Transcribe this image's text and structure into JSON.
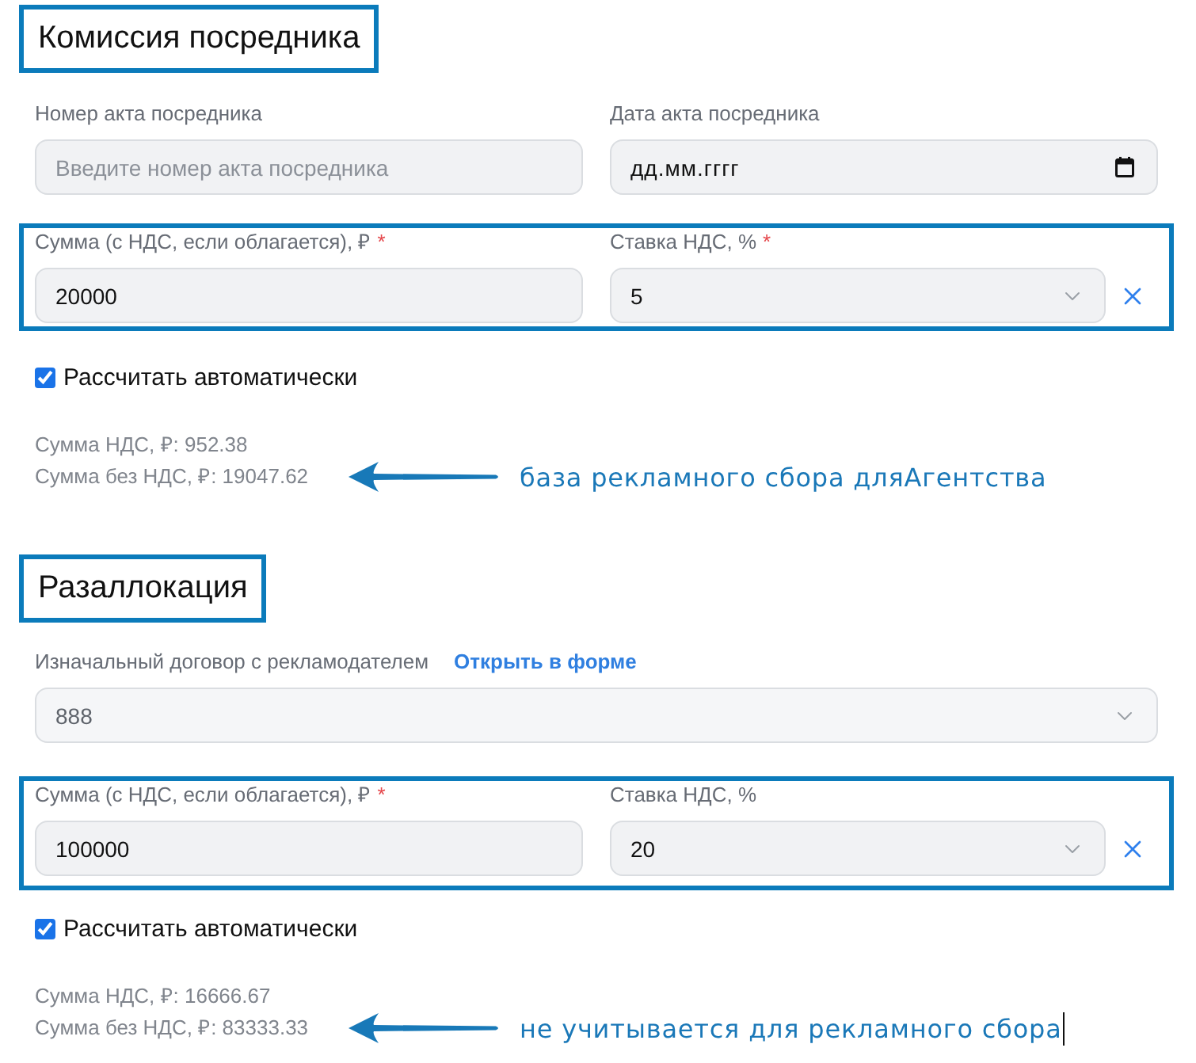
{
  "sections": [
    {
      "title": {
        "text": "Комиссия посредника",
        "highlighted": true
      },
      "act_fields": [
        {
          "kind": "text",
          "label": "Номер акта посредника",
          "placeholder": "Введите номер акта посредника"
        },
        {
          "kind": "date",
          "label": "Дата акта посредника",
          "placeholder": "дд.мм.гггг"
        }
      ],
      "amount_row": {
        "highlighted": true,
        "clearable": true,
        "amount": {
          "label": "Сумма (с НДС, если облагается), ₽",
          "required_mark": "*",
          "value": "20000"
        },
        "vat_rate": {
          "label": "Ставка НДС, %",
          "required_mark": "*",
          "value": "5"
        }
      },
      "auto_calc": {
        "label": "Рассчитать автоматически",
        "checked": true
      },
      "totals": [
        "Сумма НДС, ₽: 952.38",
        "Сумма без НДС, ₽: 19047.62"
      ],
      "annotation": {
        "text": "база рекламного сбора дляАгентства",
        "text_cursor": false
      }
    },
    {
      "title": {
        "text": "Разаллокация",
        "highlighted": true
      },
      "contract": {
        "label": "Изначальный договор с рекламодателем",
        "link": "Открыть в форме",
        "value": "888",
        "disabled": true
      },
      "amount_row": {
        "highlighted": true,
        "clearable": true,
        "amount": {
          "label": "Сумма (с НДС, если облагается), ₽",
          "required_mark": "*",
          "value": "100000"
        },
        "vat_rate": {
          "label": "Ставка НДС, %",
          "value": "20"
        }
      },
      "auto_calc": {
        "label": "Рассчитать автоматически",
        "checked": true
      },
      "totals": [
        "Сумма НДС, ₽: 16666.67",
        "Сумма без НДС, ₽: 83333.33"
      ],
      "annotation": {
        "text": "не учитывается для рекламного сбора",
        "text_cursor": true
      }
    }
  ]
}
